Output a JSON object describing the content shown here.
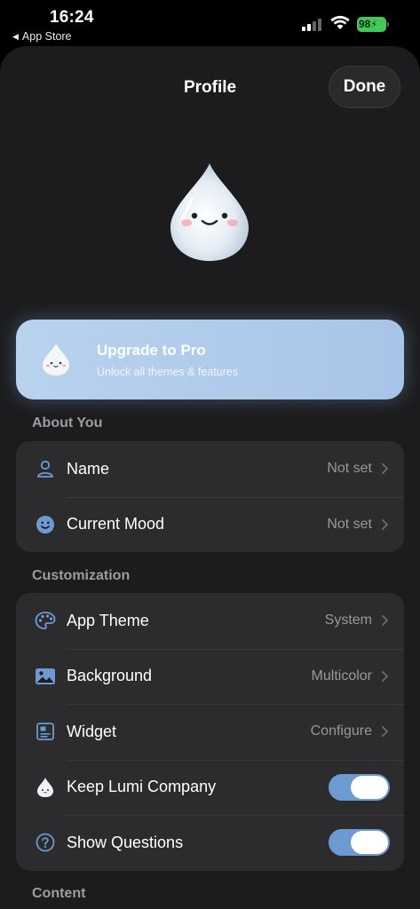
{
  "status": {
    "time": "16:24",
    "back_app": "App Store",
    "battery": "98"
  },
  "nav": {
    "title": "Profile",
    "done_label": "Done"
  },
  "upgrade": {
    "title": "Upgrade to Pro",
    "subtitle": "Unlock all themes & features"
  },
  "about": {
    "header": "About You",
    "rows": [
      {
        "label": "Name",
        "value": "Not set",
        "icon": "person-icon"
      },
      {
        "label": "Current Mood",
        "value": "Not set",
        "icon": "smiley-icon"
      }
    ]
  },
  "customization": {
    "header": "Customization",
    "rows": [
      {
        "label": "App Theme",
        "value": "System",
        "icon": "palette-icon"
      },
      {
        "label": "Background",
        "value": "Multicolor",
        "icon": "image-icon"
      },
      {
        "label": "Widget",
        "value": "Configure",
        "icon": "widget-icon"
      },
      {
        "label": "Keep Lumi Company",
        "toggle": true,
        "icon": "droplet-icon"
      },
      {
        "label": "Show Questions",
        "toggle": true,
        "icon": "question-icon"
      }
    ]
  },
  "content": {
    "header": "Content"
  },
  "colors": {
    "accent": "#6e9ad2",
    "sheet": "#1c1c1e",
    "group": "#2c2c2e",
    "battery": "#43c759"
  }
}
